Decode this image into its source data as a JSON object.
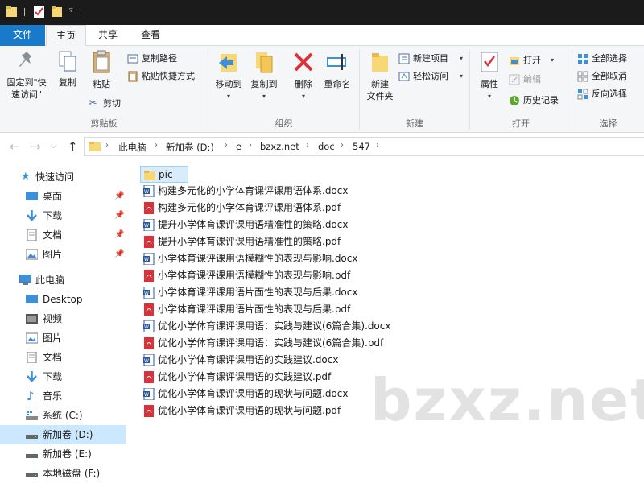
{
  "titlebar": {
    "bg": "#1b1b1b"
  },
  "tabs": [
    {
      "label": "文件"
    },
    {
      "label": "主页"
    },
    {
      "label": "共享"
    },
    {
      "label": "查看"
    }
  ],
  "ribbon": {
    "clipboard": {
      "label": "剪贴板",
      "pin_label_1": "固定到\"快",
      "pin_label_2": "速访问\"",
      "copy": "复制",
      "paste": "粘贴",
      "copy_path": "复制路径",
      "paste_shortcut": "粘贴快捷方式",
      "cut": "剪切"
    },
    "organize": {
      "label": "组织",
      "move_to": "移动到",
      "copy_to": "复制到",
      "delete": "删除",
      "rename": "重命名"
    },
    "new": {
      "label": "新建",
      "new_folder_1": "新建",
      "new_folder_2": "文件夹",
      "new_item": "新建项目",
      "easy_access": "轻松访问"
    },
    "open": {
      "label": "打开",
      "properties": "属性",
      "open": "打开",
      "edit": "编辑",
      "history": "历史记录"
    },
    "select": {
      "label": "选择",
      "select_all": "全部选择",
      "select_none": "全部取消",
      "invert": "反向选择"
    }
  },
  "address": {
    "crumbs": [
      "此电脑",
      "新加卷 (D:)",
      "e",
      "bzxz.net",
      "doc",
      "547"
    ]
  },
  "navpane": {
    "quick_access": "快速访问",
    "quick_items": [
      "桌面",
      "下载",
      "文档",
      "图片"
    ],
    "this_pc": "此电脑",
    "pc_items": [
      "Desktop",
      "视频",
      "图片",
      "文档",
      "下载",
      "音乐",
      "系统 (C:)",
      "新加卷 (D:)",
      "新加卷 (E:)",
      "本地磁盘 (F:)"
    ]
  },
  "files": [
    {
      "name": "pic",
      "type": "folder"
    },
    {
      "name": "构建多元化的小学体育课评课用语体系.docx",
      "type": "docx"
    },
    {
      "name": "构建多元化的小学体育课评课用语体系.pdf",
      "type": "pdf"
    },
    {
      "name": "提升小学体育课评课用语精准性的策略.docx",
      "type": "docx"
    },
    {
      "name": "提升小学体育课评课用语精准性的策略.pdf",
      "type": "pdf"
    },
    {
      "name": "小学体育课评课用语模糊性的表现与影响.docx",
      "type": "docx"
    },
    {
      "name": "小学体育课评课用语模糊性的表现与影响.pdf",
      "type": "pdf"
    },
    {
      "name": "小学体育课评课用语片面性的表现与后果.docx",
      "type": "docx"
    },
    {
      "name": "小学体育课评课用语片面性的表现与后果.pdf",
      "type": "pdf"
    },
    {
      "name": "优化小学体育课评课用语：实践与建议(6篇合集).docx",
      "type": "docx"
    },
    {
      "name": "优化小学体育课评课用语：实践与建议(6篇合集).pdf",
      "type": "pdf"
    },
    {
      "name": "优化小学体育课评课用语的实践建议.docx",
      "type": "docx"
    },
    {
      "name": "优化小学体育课评课用语的实践建议.pdf",
      "type": "pdf"
    },
    {
      "name": "优化小学体育课评课用语的现状与问题.docx",
      "type": "docx"
    },
    {
      "name": "优化小学体育课评课用语的现状与问题.pdf",
      "type": "pdf"
    }
  ],
  "watermark": "bzxz.net",
  "colors": {
    "accent": "#1979ca",
    "selection": "#cce8ff",
    "folder": "#f8d775",
    "pdf": "#d9323a",
    "word": "#2b579a"
  }
}
